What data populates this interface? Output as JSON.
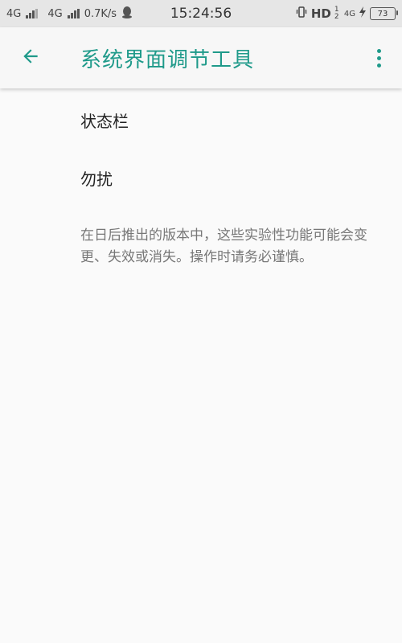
{
  "status_bar": {
    "network1": "4G",
    "network2": "4G",
    "speed": "0.7K/s",
    "time": "15:24:56",
    "hd": "HD",
    "hd_sub": "1 2",
    "network3": "4G",
    "battery": "73"
  },
  "app_bar": {
    "title": "系统界面调节工具",
    "accent_color": "#1f9a8a",
    "back_icon": "arrow-left-icon",
    "more_icon": "more-vert-icon"
  },
  "items": [
    {
      "label": "状态栏"
    },
    {
      "label": "勿扰"
    }
  ],
  "description": "在日后推出的版本中，这些实验性功能可能会变更、失效或消失。操作时请务必谨慎。"
}
